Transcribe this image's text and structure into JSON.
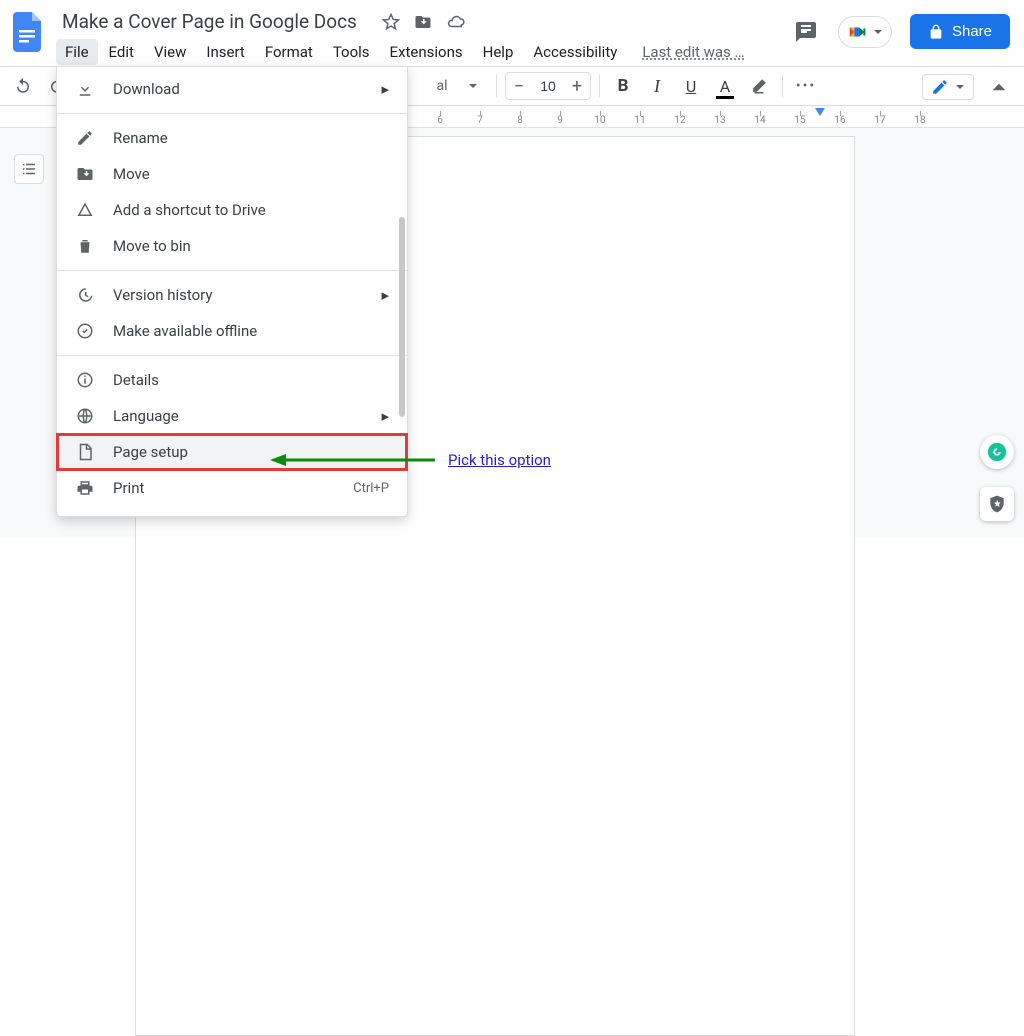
{
  "doc_title": "Make a Cover Page in Google Docs",
  "menubar": [
    "File",
    "Edit",
    "View",
    "Insert",
    "Format",
    "Tools",
    "Extensions",
    "Help",
    "Accessibility"
  ],
  "last_edit": "Last edit was …",
  "share_label": "Share",
  "toolbar": {
    "font_style_partial": "al",
    "font_size": "10"
  },
  "file_menu": {
    "download": "Download",
    "rename": "Rename",
    "move": "Move",
    "shortcut": "Add a shortcut to Drive",
    "bin": "Move to bin",
    "version": "Version history",
    "offline": "Make available offline",
    "details": "Details",
    "language": "Language",
    "page_setup": "Page setup",
    "print": "Print",
    "print_short": "Ctrl+P"
  },
  "annotation": "Pick this option",
  "ruler_ticks": [
    "6",
    "7",
    "8",
    "9",
    "10",
    "11",
    "12",
    "13",
    "14",
    "15",
    "16",
    "17",
    "18"
  ]
}
